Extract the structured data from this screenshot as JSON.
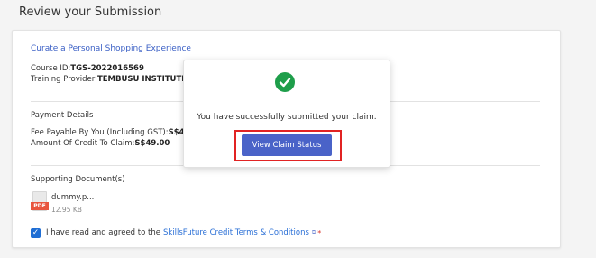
{
  "page": {
    "title": "Review your Submission"
  },
  "course": {
    "title": "Curate a Personal Shopping Experience",
    "id_label": "Course ID:",
    "id_value": "TGS-2022016569",
    "provider_label": "Training Provider:",
    "provider_value": "TEMBUSU INSTITUTE PTE"
  },
  "payment": {
    "heading": "Payment Details",
    "fee_label": "Fee Payable By You (Including GST):",
    "fee_value": "S$49.0",
    "credit_label": "Amount Of Credit To Claim:",
    "credit_value": "S$49.00"
  },
  "documents": {
    "heading": "Supporting Document(s)",
    "file_name": "dummy.p...",
    "file_size": "12.95 KB",
    "file_type": "PDF"
  },
  "agreement": {
    "checked": true,
    "text": "I have read and agreed to the",
    "link_text": "SkillsFuture Credit Terms & Conditions",
    "required_mark": "*"
  },
  "modal": {
    "message": "You have successfully submitted your claim.",
    "button_label": "View Claim Status"
  },
  "colors": {
    "success": "#1e9e4a",
    "button": "#4a63c8",
    "highlight": "#e12323",
    "link": "#2a6fd6"
  }
}
